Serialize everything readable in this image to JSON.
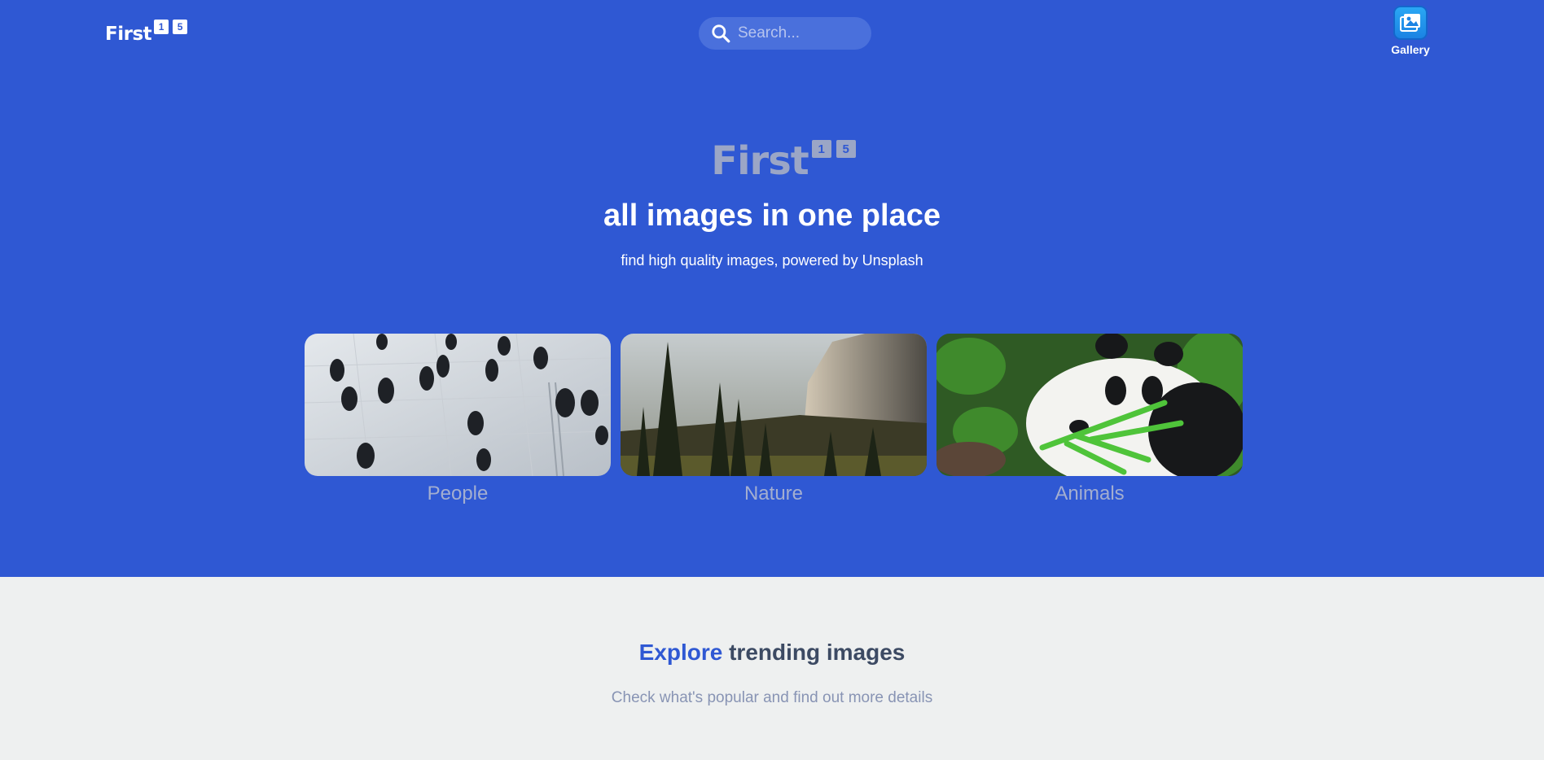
{
  "header": {
    "logo_text": "First",
    "logo_badges": [
      "1",
      "5"
    ],
    "search_placeholder": "Search...",
    "gallery_label": "Gallery"
  },
  "hero": {
    "brand_text": "First",
    "brand_badges": [
      "1",
      "5"
    ],
    "tagline": "all images in one place",
    "subtitle": "find high quality images, powered by Unsplash"
  },
  "categories": [
    {
      "label": "People"
    },
    {
      "label": "Nature"
    },
    {
      "label": "Animals"
    }
  ],
  "explore": {
    "accent": "Explore",
    "rest": " trending images",
    "subtitle": "Check what's popular and find out more details"
  },
  "colors": {
    "hero_bg": "#2f58d3",
    "page_bg": "#eef0f0",
    "accent": "#2f58d3"
  }
}
